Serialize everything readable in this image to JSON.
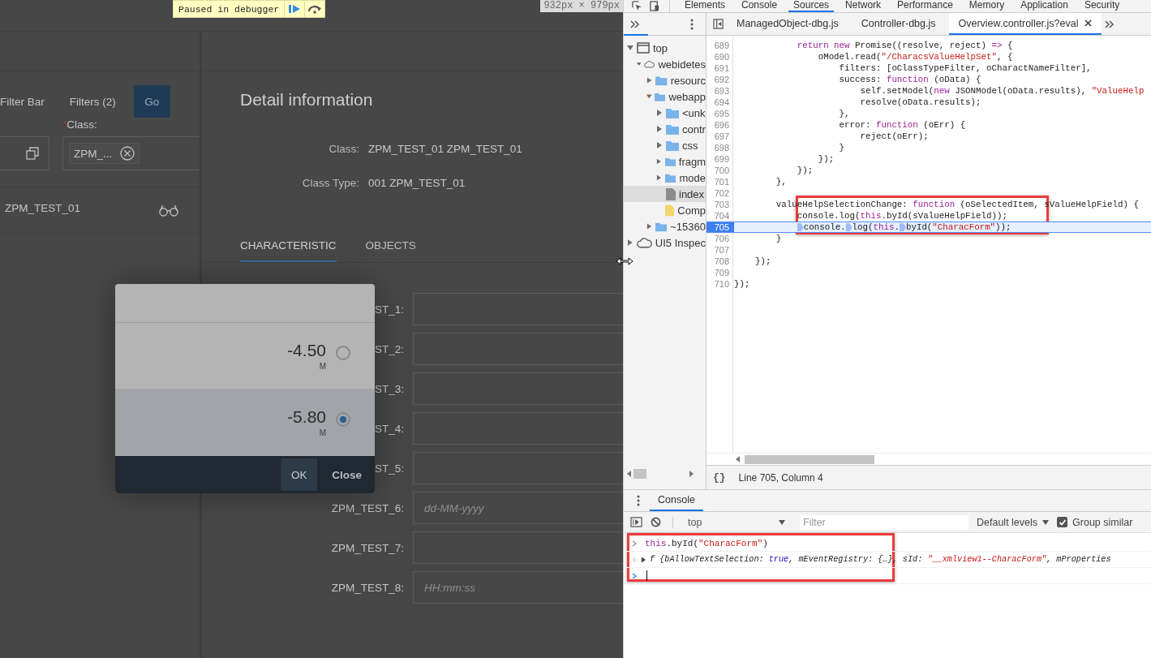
{
  "debugger_badge": {
    "text": "Paused in debugger"
  },
  "viewport_size": "932px × 979px",
  "app": {
    "filter_bar": {
      "items": [
        "Filter Bar",
        "Filters (2)"
      ],
      "go": "Go"
    },
    "class_filter": {
      "required_mark": "*",
      "label": "Class:",
      "token": "ZPM_..."
    },
    "result_row": "ZPM_TEST_01",
    "detail": {
      "title": "Detail information",
      "fields": [
        {
          "label": "Class:",
          "value": "ZPM_TEST_01 ZPM_TEST_01"
        },
        {
          "label": "Class Type:",
          "value": "001 ZPM_TEST_01"
        }
      ],
      "tabs": [
        {
          "label": "CHARACTERISTIC",
          "selected": true
        },
        {
          "label": "OBJECTS",
          "selected": false
        }
      ],
      "form": [
        {
          "label": "ST_1:"
        },
        {
          "label": "ST_2:"
        },
        {
          "label": "ST_3:"
        },
        {
          "label": "ST_4:"
        },
        {
          "label": "ST_5:"
        },
        {
          "label": "ZPM_TEST_6:",
          "placeholder": "dd-MM-yyyy"
        },
        {
          "label": "ZPM_TEST_7:"
        },
        {
          "label": "ZPM_TEST_8:",
          "placeholder": "HH:mm:ss"
        }
      ]
    },
    "dialog": {
      "options": [
        {
          "value": "-4.50",
          "unit": "M",
          "selected": false
        },
        {
          "value": "-5.80",
          "unit": "M",
          "selected": true
        }
      ],
      "buttons": [
        {
          "label": "OK",
          "kind": "emphasized"
        },
        {
          "label": "Close",
          "kind": "transparent"
        }
      ]
    }
  },
  "devtools": {
    "tabs": [
      {
        "label": "Elements",
        "selected": false
      },
      {
        "label": "Console",
        "selected": false
      },
      {
        "label": "Sources",
        "selected": true
      },
      {
        "label": "Network",
        "selected": false
      },
      {
        "label": "Performance",
        "selected": false
      },
      {
        "label": "Memory",
        "selected": false
      },
      {
        "label": "Application",
        "selected": false
      },
      {
        "label": "Security",
        "selected": false
      }
    ],
    "file_tabs": [
      {
        "label": "ManagedObject-dbg.js",
        "selected": false
      },
      {
        "label": "Controller-dbg.js",
        "selected": false
      },
      {
        "label": "Overview.controller.js?eval",
        "selected": true
      }
    ],
    "navigator": [
      {
        "label": "top",
        "kind": "frame",
        "selected": false,
        "expanded": true,
        "children": [
          {
            "label": "webidetes",
            "kind": "cloud",
            "selected": false,
            "expanded": true,
            "children": [
              {
                "label": "resourc",
                "kind": "folder",
                "selected": false,
                "expanded": false
              },
              {
                "label": "webapp",
                "kind": "folder",
                "selected": false,
                "expanded": true,
                "children": [
                  {
                    "label": "<unk",
                    "kind": "folder",
                    "selected": false,
                    "expanded": false
                  },
                  {
                    "label": "contr",
                    "kind": "folder",
                    "selected": false,
                    "expanded": false
                  },
                  {
                    "label": "css",
                    "kind": "folder",
                    "selected": false,
                    "expanded": false
                  },
                  {
                    "label": "fragm",
                    "kind": "folder",
                    "selected": false,
                    "expanded": false
                  },
                  {
                    "label": "mode",
                    "kind": "folder",
                    "selected": false,
                    "expanded": false
                  },
                  {
                    "label": "index",
                    "kind": "file",
                    "selected": true
                  },
                  {
                    "label": "Comp",
                    "kind": "script",
                    "selected": false
                  }
                ]
              },
              {
                "label": "~15360",
                "kind": "folder",
                "selected": false,
                "expanded": false
              }
            ]
          }
        ]
      },
      {
        "label": "UI5 Inspec",
        "kind": "cloud",
        "selected": false,
        "expanded": false
      }
    ],
    "code": {
      "callout": true,
      "lines": [
        {
          "number": "689",
          "current": false,
          "tokens": [
            {
              "kind": "keyword",
              "text": "            return new"
            },
            {
              "kind": "plain",
              "text": " Promise((resolve, reject) "
            },
            {
              "kind": "keyword",
              "text": "=>"
            },
            {
              "kind": "plain",
              "text": " {"
            }
          ]
        },
        {
          "number": "690",
          "current": false,
          "tokens": [
            {
              "kind": "plain",
              "text": "                oModel.read("
            },
            {
              "kind": "string",
              "text": "\"/CharacsValueHelpSet\""
            },
            {
              "kind": "plain",
              "text": ", {"
            }
          ]
        },
        {
          "number": "691",
          "current": false,
          "tokens": [
            {
              "kind": "plain",
              "text": "                    filters: [oClassTypeFilter, oCharactNameFilter],"
            }
          ]
        },
        {
          "number": "692",
          "current": false,
          "tokens": [
            {
              "kind": "plain",
              "text": "                    success: "
            },
            {
              "kind": "keyword",
              "text": "function"
            },
            {
              "kind": "plain",
              "text": " (oData) {"
            }
          ]
        },
        {
          "number": "693",
          "current": false,
          "tokens": [
            {
              "kind": "plain",
              "text": "                        self.setModel("
            },
            {
              "kind": "keyword",
              "text": "new"
            },
            {
              "kind": "plain",
              "text": " JSONModel(oData.results), "
            },
            {
              "kind": "string",
              "text": "\"ValueHelp"
            }
          ]
        },
        {
          "number": "694",
          "current": false,
          "tokens": [
            {
              "kind": "plain",
              "text": "                        resolve(oData.results);"
            }
          ]
        },
        {
          "number": "695",
          "current": false,
          "tokens": [
            {
              "kind": "plain",
              "text": "                    },"
            }
          ]
        },
        {
          "number": "696",
          "current": false,
          "tokens": [
            {
              "kind": "plain",
              "text": "                    error: "
            },
            {
              "kind": "keyword",
              "text": "function"
            },
            {
              "kind": "plain",
              "text": " (oErr) {"
            }
          ]
        },
        {
          "number": "697",
          "current": false,
          "tokens": [
            {
              "kind": "plain",
              "text": "                        reject(oErr);"
            }
          ]
        },
        {
          "number": "698",
          "current": false,
          "tokens": [
            {
              "kind": "plain",
              "text": "                    }"
            }
          ]
        },
        {
          "number": "699",
          "current": false,
          "tokens": [
            {
              "kind": "plain",
              "text": "                });"
            }
          ]
        },
        {
          "number": "700",
          "current": false,
          "tokens": [
            {
              "kind": "plain",
              "text": "            });"
            }
          ]
        },
        {
          "number": "701",
          "current": false,
          "tokens": [
            {
              "kind": "plain",
              "text": "        },"
            }
          ]
        },
        {
          "number": "702",
          "current": false
        },
        {
          "number": "703",
          "current": false,
          "tokens": [
            {
              "kind": "plain",
              "text": "        valueHelpSelectionChange: "
            },
            {
              "kind": "keyword",
              "text": "function"
            },
            {
              "kind": "plain",
              "text": " (oSelectedItem, sValueHelpField) {"
            }
          ]
        },
        {
          "number": "704",
          "current": false,
          "tokens": [
            {
              "kind": "plain",
              "text": "            console.log("
            },
            {
              "kind": "keyword",
              "text": "this"
            },
            {
              "kind": "plain",
              "text": ".byId(sValueHelpField));"
            }
          ]
        },
        {
          "number": "705",
          "current": true,
          "tokens": [
            {
              "kind": "plain",
              "text": "            console.",
              "breakpoint": true
            },
            {
              "kind": "plain",
              "text": "log(",
              "breakpoint": true
            },
            {
              "kind": "keyword",
              "text": "this"
            },
            {
              "kind": "plain",
              "text": "."
            },
            {
              "kind": "plain",
              "text": "byId(",
              "breakpoint": true
            },
            {
              "kind": "string",
              "text": "\"CharacForm\""
            },
            {
              "kind": "plain",
              "text": "));"
            }
          ]
        },
        {
          "number": "706",
          "current": false,
          "tokens": [
            {
              "kind": "plain",
              "text": "        }"
            }
          ]
        },
        {
          "number": "707",
          "current": false
        },
        {
          "number": "708",
          "current": false,
          "tokens": [
            {
              "kind": "plain",
              "text": "    });"
            }
          ]
        },
        {
          "number": "709",
          "current": false
        },
        {
          "number": "710",
          "current": false,
          "tokens": [
            {
              "kind": "plain",
              "text": "});"
            }
          ]
        }
      ]
    },
    "pretty_print": "{}",
    "status": "Line 705, Column 4",
    "drawer": {
      "tab": "Console",
      "context": "top",
      "filter_placeholder": "Filter",
      "levels": "Default levels",
      "group_similar": {
        "label": "Group similar",
        "checked": true
      },
      "callout": true,
      "entries": [
        {
          "kind": "input",
          "tokens": [
            {
              "kind": "keyword",
              "text": "this"
            },
            {
              "kind": "plain",
              "text": ".byId("
            },
            {
              "kind": "string",
              "text": "\"CharacForm\""
            },
            {
              "kind": "plain",
              "text": ")"
            }
          ]
        },
        {
          "kind": "output",
          "tokens": [
            {
              "kind": "plain",
              "text": "f {bAllowTextSelection: "
            },
            {
              "kind": "literal",
              "text": "true"
            },
            {
              "kind": "plain",
              "text": ", mEventRegistry: {…}, sId: "
            },
            {
              "kind": "string",
              "text": "\"__xmlview1--CharacForm\""
            },
            {
              "kind": "plain",
              "text": ", mProperties"
            }
          ]
        }
      ]
    }
  }
}
